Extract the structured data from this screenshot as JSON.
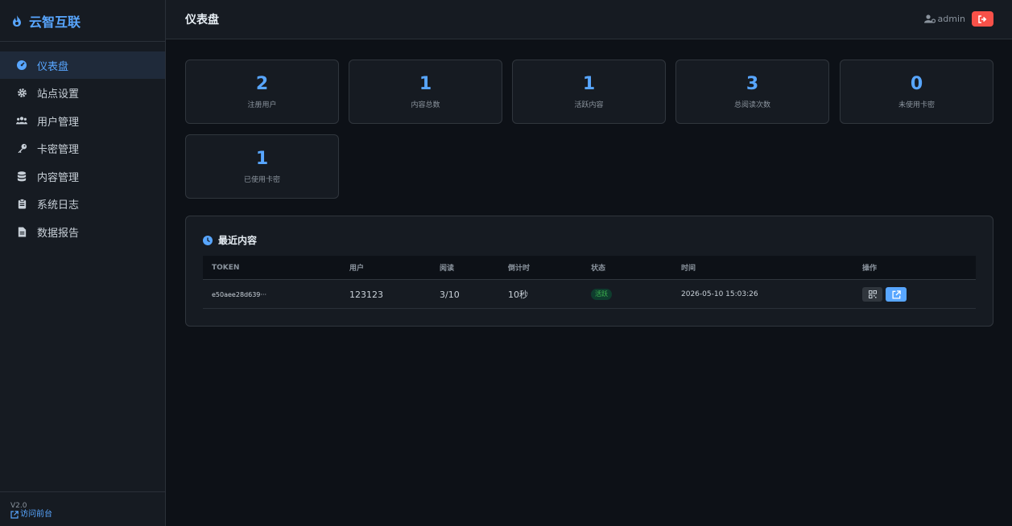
{
  "brand": {
    "name": "云智互联",
    "accent": "#58a6ff"
  },
  "sidebar": {
    "items": [
      {
        "label": "仪表盘",
        "icon": "dashboard-icon",
        "active": true
      },
      {
        "label": "站点设置",
        "icon": "gear-icon",
        "active": false
      },
      {
        "label": "用户管理",
        "icon": "users-icon",
        "active": false
      },
      {
        "label": "卡密管理",
        "icon": "key-icon",
        "active": false
      },
      {
        "label": "内容管理",
        "icon": "database-icon",
        "active": false
      },
      {
        "label": "系统日志",
        "icon": "clipboard-icon",
        "active": false
      },
      {
        "label": "数据报告",
        "icon": "file-icon",
        "active": false
      }
    ],
    "version": "V2.0",
    "visit_label": "访问前台"
  },
  "header": {
    "title": "仪表盘",
    "username": "admin",
    "logout_color": "#f85149"
  },
  "stats": [
    {
      "value": "2",
      "label": "注册用户"
    },
    {
      "value": "1",
      "label": "内容总数"
    },
    {
      "value": "1",
      "label": "活跃内容"
    },
    {
      "value": "3",
      "label": "总阅读次数"
    },
    {
      "value": "0",
      "label": "未使用卡密"
    },
    {
      "value": "1",
      "label": "已使用卡密"
    }
  ],
  "recent": {
    "title": "最近内容",
    "columns": [
      "TOKEN",
      "用户",
      "阅读",
      "倒计时",
      "状态",
      "时间",
      "操作"
    ],
    "rows": [
      {
        "token": "e50aee28d639···",
        "user": "123123",
        "reads": "3/10",
        "countdown": "10秒",
        "status": "活跃",
        "time": "2026-05-10 15:03:26"
      }
    ]
  }
}
